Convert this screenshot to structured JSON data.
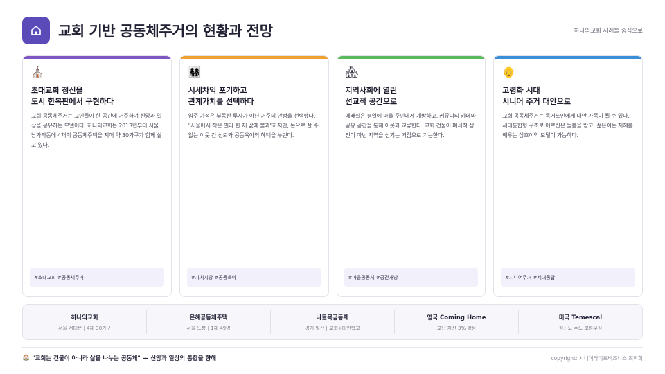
{
  "header": {
    "icon": "home-icon",
    "title": "교회 기반 공동체주거의 현황과 전망",
    "subtitle": "하나의교회 사례를 중심으로"
  },
  "cards": [
    {
      "icon": "church-icon",
      "emoji": "⛪",
      "accent": "#7e57c2",
      "title_line1": "초대교회 정신을",
      "title_line2": "도시 한복판에서 구현하다",
      "body": "교회 공동체주거는 교인들이 한 공간에 거주하며 신앙과 일상을 공유하는 모델이다. 하나의교회는 2013년부터 서울 남가좌동에 4채의 공동체주택을 지어 약 30가구가 함께 살고 있다.",
      "tags": "#초대교회 #공동체주거"
    },
    {
      "icon": "family-icon",
      "emoji": "👨‍👩‍👧‍👦",
      "accent": "#f0a030",
      "title_line1": "시세차익 포기하고",
      "title_line2": "관계가치를 선택하다",
      "body": "입주 가정은 부동산 투자가 아닌 거주의 안정을 선택했다. \"서울에서 작은 빌라 한 채 값에 불과\"하지만, 돈으로 살 수 없는 이웃 간 신뢰와 공동육아의 혜택을 누린다.",
      "tags": "#가치지향 #공동육아"
    },
    {
      "icon": "houses-icon",
      "emoji": "🏘",
      "accent": "#5cb85c",
      "title_line1": "지역사회에 열린",
      "title_line2": "선교적 공간으로",
      "body": "예배실은 평일에 마을 주민에게 개방하고, 커뮤니티 카페와 공유 공간을 통해 이웃과 교류한다. 교회 건물이 폐쇄적 성전이 아닌 지역을 섬기는 거점으로 기능한다.",
      "tags": "#마을공동체 #공간개방"
    },
    {
      "icon": "elder-icon",
      "emoji": "👴",
      "accent": "#3b8fd9",
      "title_line1": "고령화 시대",
      "title_line2": "시니어 주거 대안으로",
      "body": "교회 공동체주거는 독거노인에게 대안 가족이 될 수 있다. 세대통합형 구조로 어르신은 돌봄을 받고, 젊은이는 지혜를 배우는 상호이익 모델이 가능하다.",
      "tags": "#시니어주거 #세대통합"
    }
  ],
  "examples": [
    {
      "name": "하나의교회",
      "detail": "서울 서대문 | 4채 30가구"
    },
    {
      "name": "은혜공동체주택",
      "detail": "서울 도봉 | 1채 49명"
    },
    {
      "name": "나들목공동체",
      "detail": "경기 일산 | 교회+대안학교"
    },
    {
      "name": "영국 Coming Home",
      "detail": "교단 자산 3% 활용"
    },
    {
      "name": "미국 Temescal",
      "detail": "평신도 주도 코하우징"
    }
  ],
  "footer": {
    "icon": "home-icon",
    "emoji": "🏠",
    "quote": "\"교회는 건물이 아니라 삶을 나누는 공동체\" — 신앙과 일상의 통합을 향해",
    "copyright": "copyright: 시니어라이프비즈니스 최학희"
  }
}
